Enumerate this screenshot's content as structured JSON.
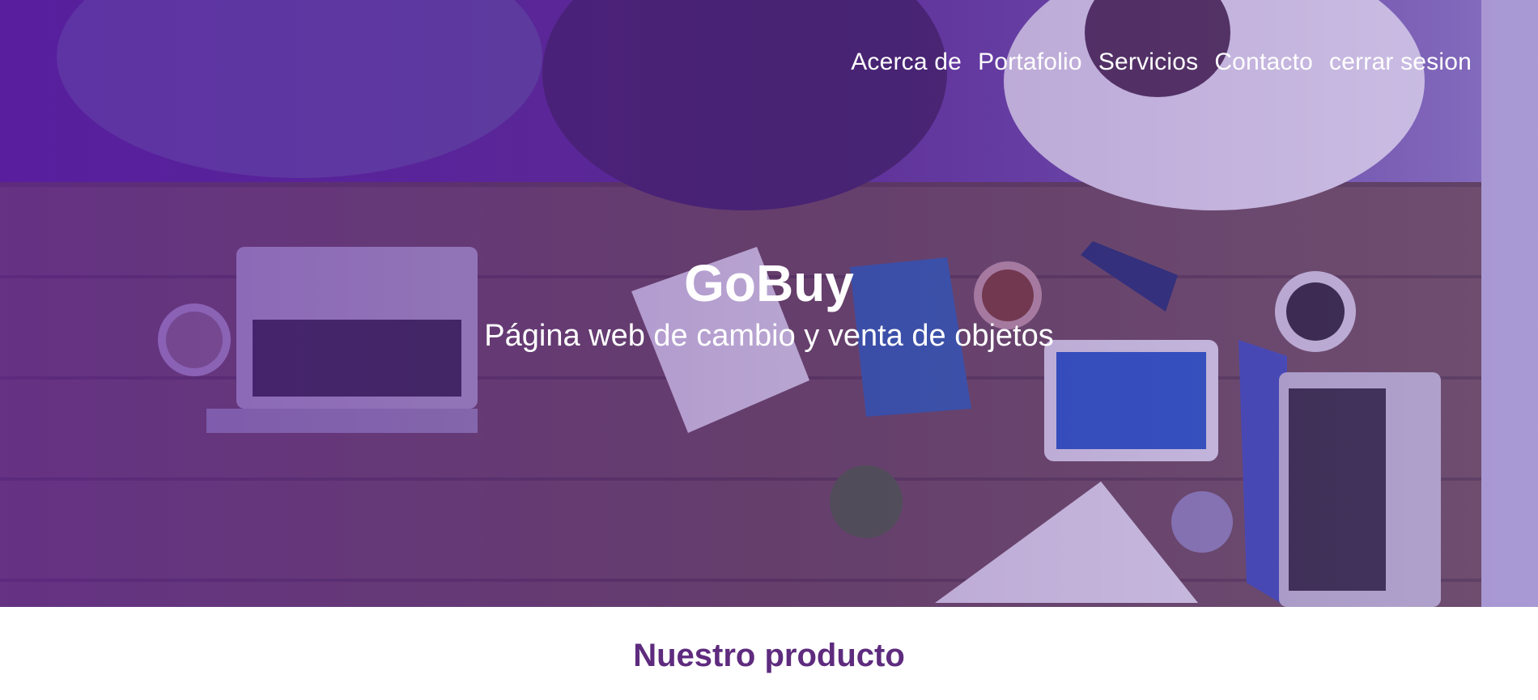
{
  "nav": {
    "items": [
      {
        "label": "Acerca de"
      },
      {
        "label": "Portafolio"
      },
      {
        "label": "Servicios"
      },
      {
        "label": "Contacto"
      },
      {
        "label": "cerrar sesion"
      }
    ]
  },
  "hero": {
    "title": "GoBuy",
    "subtitle": "Página web de cambio y venta de objetos"
  },
  "products": {
    "title": "Nuestro producto"
  },
  "colors": {
    "overlay_purple": "#5a2a95",
    "section_title": "#5e2b7e",
    "nav_text": "#ffffff"
  }
}
